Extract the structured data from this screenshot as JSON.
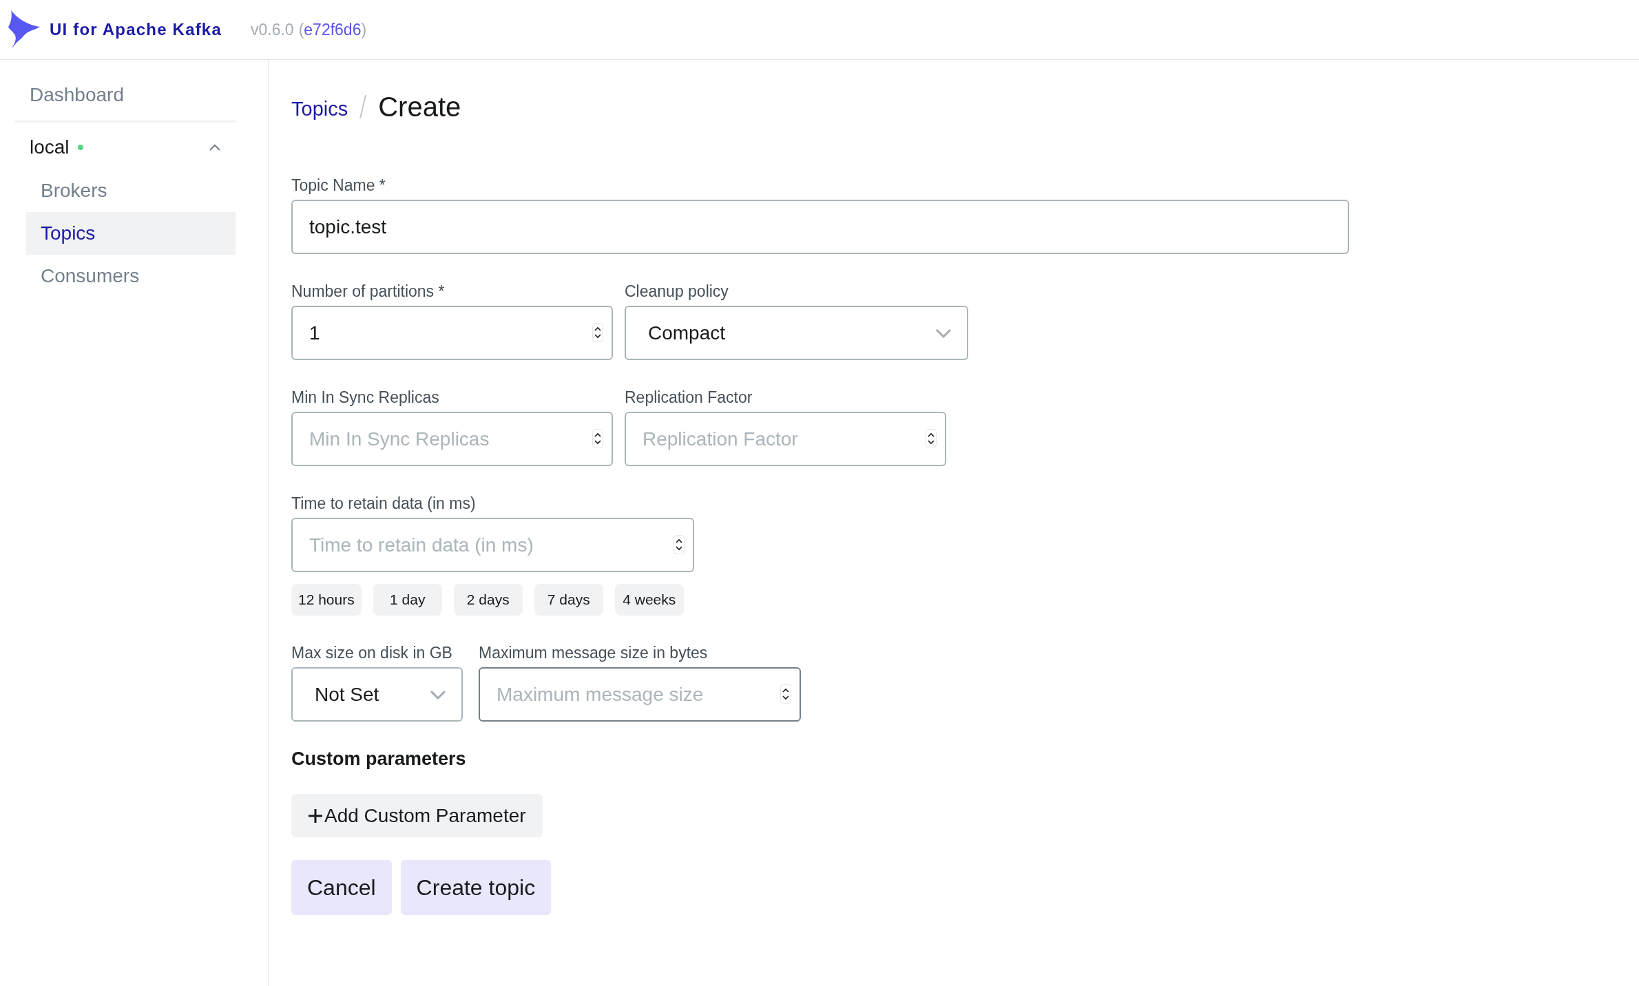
{
  "header": {
    "app_title": "UI for Apache Kafka",
    "version": "v0.6.0",
    "commit_open": "(",
    "commit": "e72f6d6",
    "commit_close": ")"
  },
  "sidebar": {
    "items": [
      {
        "label": "Dashboard",
        "selected": false
      }
    ],
    "clusters": [
      {
        "name": "local",
        "online": true,
        "expanded": true,
        "children": [
          {
            "label": "Brokers",
            "selected": false
          },
          {
            "label": "Topics",
            "selected": true
          },
          {
            "label": "Consumers",
            "selected": false
          }
        ]
      }
    ]
  },
  "breadcrumb": {
    "parent": "Topics",
    "current": "Create"
  },
  "form": {
    "rows": [
      [
        {
          "kind": "text",
          "label": "Topic Name *",
          "value": "topic.test",
          "focused": false
        }
      ],
      [
        {
          "kind": "number",
          "label": "Number of partitions *",
          "value": "1",
          "focused": false
        },
        {
          "kind": "select",
          "label": "Cleanup policy",
          "value": "Compact",
          "focused": false
        }
      ],
      [
        {
          "kind": "number",
          "label": "Min In Sync Replicas",
          "placeholder": "Min In Sync Replicas",
          "focused": false
        },
        {
          "kind": "number",
          "label": "Replication Factor",
          "placeholder": "Replication Factor",
          "focused": false
        }
      ],
      [
        {
          "kind": "number",
          "label": "Time to retain data (in ms)",
          "placeholder": "Time to retain data (in ms)",
          "focused": false,
          "presets": [
            "12 hours",
            "1 day",
            "2 days",
            "7 days",
            "4 weeks"
          ]
        }
      ],
      [
        {
          "kind": "select",
          "label": "Max size on disk in GB",
          "value": "Not Set",
          "focused": false
        },
        {
          "kind": "number",
          "label": "Maximum message size in bytes",
          "placeholder": "Maximum message size",
          "focused": true
        }
      ]
    ],
    "custom_parameters": {
      "title": "Custom parameters",
      "add_button": "Add Custom Parameter"
    },
    "buttons": [
      "Cancel",
      "Create topic"
    ]
  }
}
